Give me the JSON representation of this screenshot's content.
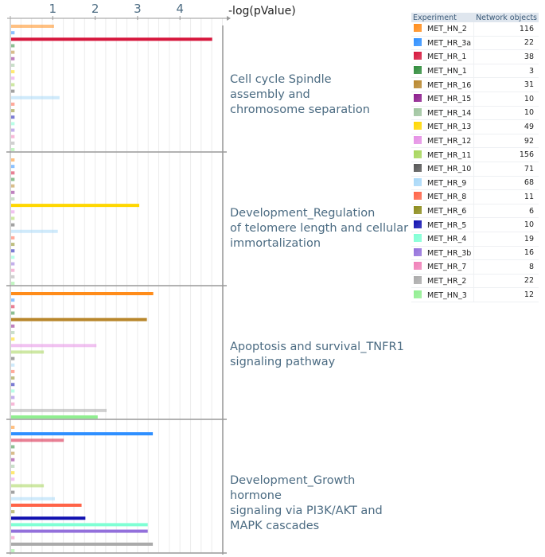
{
  "chart_data": {
    "type": "bar",
    "orientation": "horizontal",
    "xlabel": "-log(pValue)",
    "xticks": [
      1,
      2,
      3,
      4
    ],
    "xlim": [
      0,
      5
    ],
    "grid": true,
    "legend_placement": "top-right",
    "legend_headers": [
      "Experiment",
      "Network objects"
    ],
    "experiments": [
      {
        "name": "MET_HN_2",
        "color": "#ff8c1a",
        "objects": 116
      },
      {
        "name": "MET_HR_3a",
        "color": "#2e8fff",
        "objects": 22
      },
      {
        "name": "MET_HR_1",
        "color": "#d6163c",
        "objects": 38
      },
      {
        "name": "MET_HN_1",
        "color": "#2e8b3a",
        "objects": 3
      },
      {
        "name": "MET_HR_16",
        "color": "#b8862b",
        "objects": 31
      },
      {
        "name": "MET_HR_15",
        "color": "#8b1a8b",
        "objects": 10
      },
      {
        "name": "MET_HR_14",
        "color": "#9ec49e",
        "objects": 10
      },
      {
        "name": "MET_HR_13",
        "color": "#ffd700",
        "objects": 49
      },
      {
        "name": "MET_HR_12",
        "color": "#e58fe5",
        "objects": 92
      },
      {
        "name": "MET_HR_11",
        "color": "#a6d65a",
        "objects": 156
      },
      {
        "name": "MET_HR_10",
        "color": "#555555",
        "objects": 71
      },
      {
        "name": "MET_HR_9",
        "color": "#a8d8f8",
        "objects": 68
      },
      {
        "name": "MET_HR_8",
        "color": "#ff6347",
        "objects": 11
      },
      {
        "name": "MET_HR_6",
        "color": "#8b8b1a",
        "objects": 6
      },
      {
        "name": "MET_HR_5",
        "color": "#1010b0",
        "objects": 10
      },
      {
        "name": "MET_HR_4",
        "color": "#7fffd4",
        "objects": 19
      },
      {
        "name": "MET_HR_3b",
        "color": "#9370db",
        "objects": 16
      },
      {
        "name": "MET_HR_7",
        "color": "#f07fb8",
        "objects": 8
      },
      {
        "name": "MET_HR_2",
        "color": "#aaaaaa",
        "objects": 22
      },
      {
        "name": "MET_HN_3",
        "color": "#90ee90",
        "objects": 12
      }
    ],
    "groups": [
      {
        "label_lines": [
          "Cell cycle  Spindle",
          "assembly and",
          "chromosome separation"
        ],
        "values": [
          1.03,
          0.1,
          4.76,
          0.1,
          0.1,
          0.1,
          0.1,
          0.1,
          0.1,
          0.1,
          0.1,
          1.16,
          0.1,
          0.1,
          0.1,
          0.1,
          0.1,
          0.1,
          0.1,
          0.1
        ],
        "highlighted": [
          "MET_HR_1"
        ]
      },
      {
        "label_lines": [
          "Development_Regulation",
          "of telomere length and cellular",
          "immortalization"
        ],
        "values": [
          0.1,
          0.1,
          0.1,
          0.1,
          0.1,
          0.1,
          0.1,
          3.04,
          0.1,
          0.1,
          0.1,
          1.12,
          0.1,
          0.1,
          0.1,
          0.1,
          0.1,
          0.1,
          0.1,
          0.1
        ],
        "highlighted": [
          "MET_HR_13"
        ]
      },
      {
        "label_lines": [
          "Apoptosis and survival_TNFR1",
          "signaling pathway"
        ],
        "values": [
          3.37,
          0.1,
          0.1,
          0.1,
          3.22,
          0.1,
          0.1,
          0.1,
          2.03,
          0.79,
          0.1,
          0.1,
          0.1,
          0.1,
          0.1,
          0.1,
          0.1,
          0.1,
          2.27,
          2.06
        ],
        "highlighted": [
          "MET_HN_2",
          "MET_HR_16",
          "MET_HN_3"
        ]
      },
      {
        "label_lines": [
          "Development_Growth hormone",
          "signaling via PI3K/AKT and",
          "MAPK cascades"
        ],
        "values": [
          0.1,
          3.36,
          1.26,
          0.1,
          0.1,
          0.1,
          0.1,
          0.1,
          0.1,
          0.79,
          0.1,
          1.05,
          1.68,
          0.1,
          1.77,
          3.24,
          3.24,
          0.1,
          3.36,
          0.1
        ],
        "highlighted": [
          "MET_HR_3a",
          "MET_HR_8",
          "MET_HR_5",
          "MET_HR_4",
          "MET_HR_3b",
          "MET_HR_2"
        ]
      }
    ]
  }
}
